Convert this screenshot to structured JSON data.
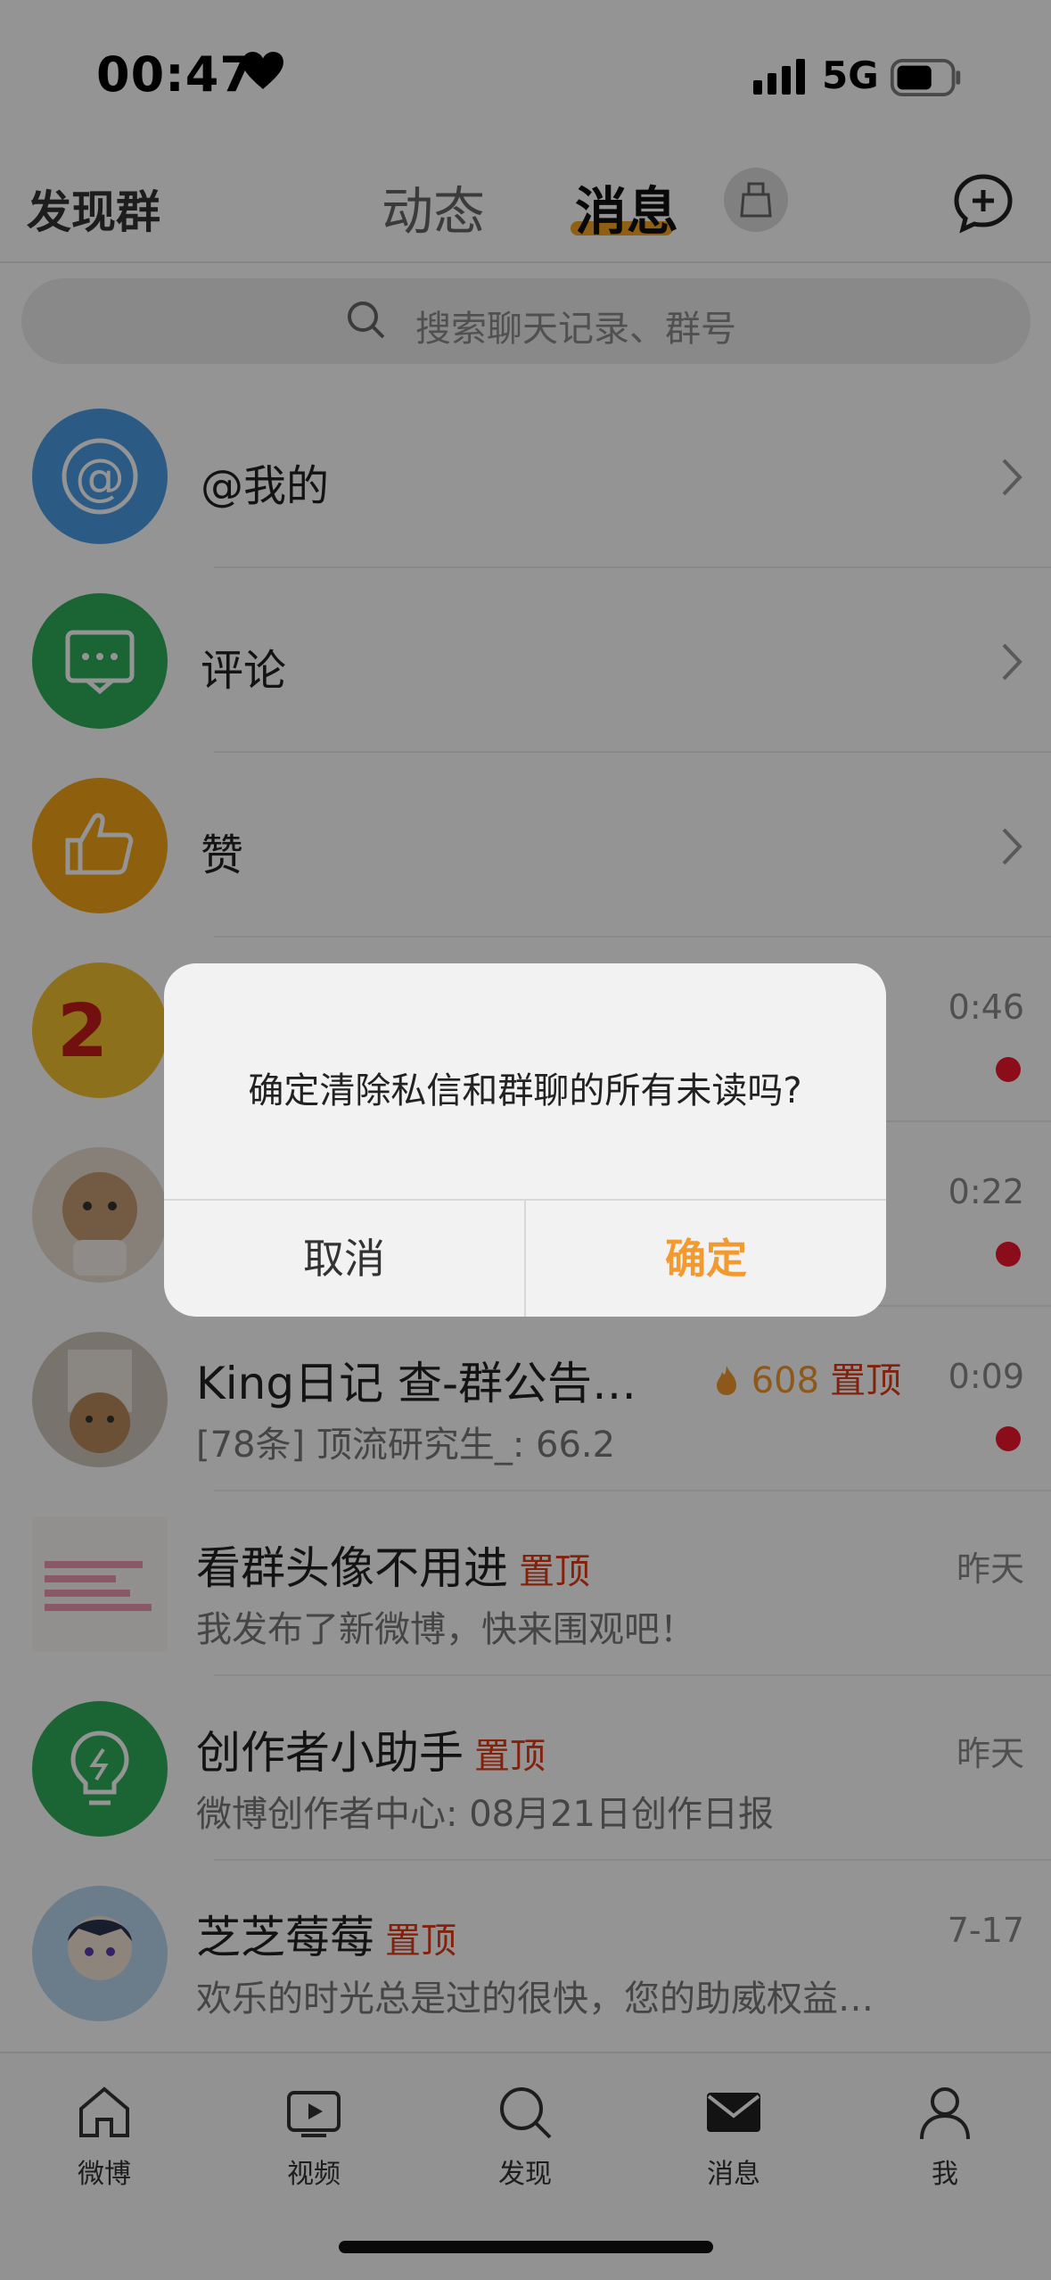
{
  "status_bar": {
    "time": "00:47",
    "network": "5G"
  },
  "nav": {
    "left": "发现群",
    "tabs": [
      {
        "label": "动态"
      },
      {
        "label": "消息"
      }
    ]
  },
  "search": {
    "placeholder": "搜索聊天记录、群号"
  },
  "sections": [
    {
      "label": "@我的",
      "icon": "at-icon",
      "color": "#4a9ee6"
    },
    {
      "label": "评论",
      "icon": "comment-icon",
      "color": "#2fae5b"
    },
    {
      "label": "赞",
      "icon": "thumbs-up-icon",
      "color": "#f5a417"
    }
  ],
  "chats": [
    {
      "time": "0:46",
      "unread": true,
      "avatar_text": "2"
    },
    {
      "time": "0:22",
      "unread": true
    },
    {
      "title": "King日记  查-群公告…",
      "hot_count": "608",
      "pin_label": "置顶",
      "subtitle": "[78条] 顶流研究生_: 66.2",
      "time": "0:09",
      "unread": true
    },
    {
      "title": "看群头像不用进",
      "pin_label": "置顶",
      "subtitle": "我发布了新微博，快来围观吧！",
      "time": "昨天"
    },
    {
      "title": "创作者小助手",
      "pin_label": "置顶",
      "subtitle": "微博创作者中心: 08月21日创作日报",
      "time": "昨天"
    },
    {
      "title": "芝芝莓莓",
      "pin_label": "置顶",
      "subtitle": "欢乐的时光总是过的很快，您的助威权益…",
      "time": "7-17"
    }
  ],
  "tab_bar": [
    {
      "label": "微博",
      "icon": "home-icon"
    },
    {
      "label": "视频",
      "icon": "video-icon"
    },
    {
      "label": "发现",
      "icon": "search-icon"
    },
    {
      "label": "消息",
      "icon": "mail-icon"
    },
    {
      "label": "我",
      "icon": "profile-icon"
    }
  ],
  "dialog": {
    "message": "确定清除私信和群聊的所有未读吗?",
    "cancel": "取消",
    "confirm": "确定"
  },
  "colors": {
    "accent": "#f29a2e",
    "pin": "#e03c18",
    "unread": "#f0182d"
  }
}
